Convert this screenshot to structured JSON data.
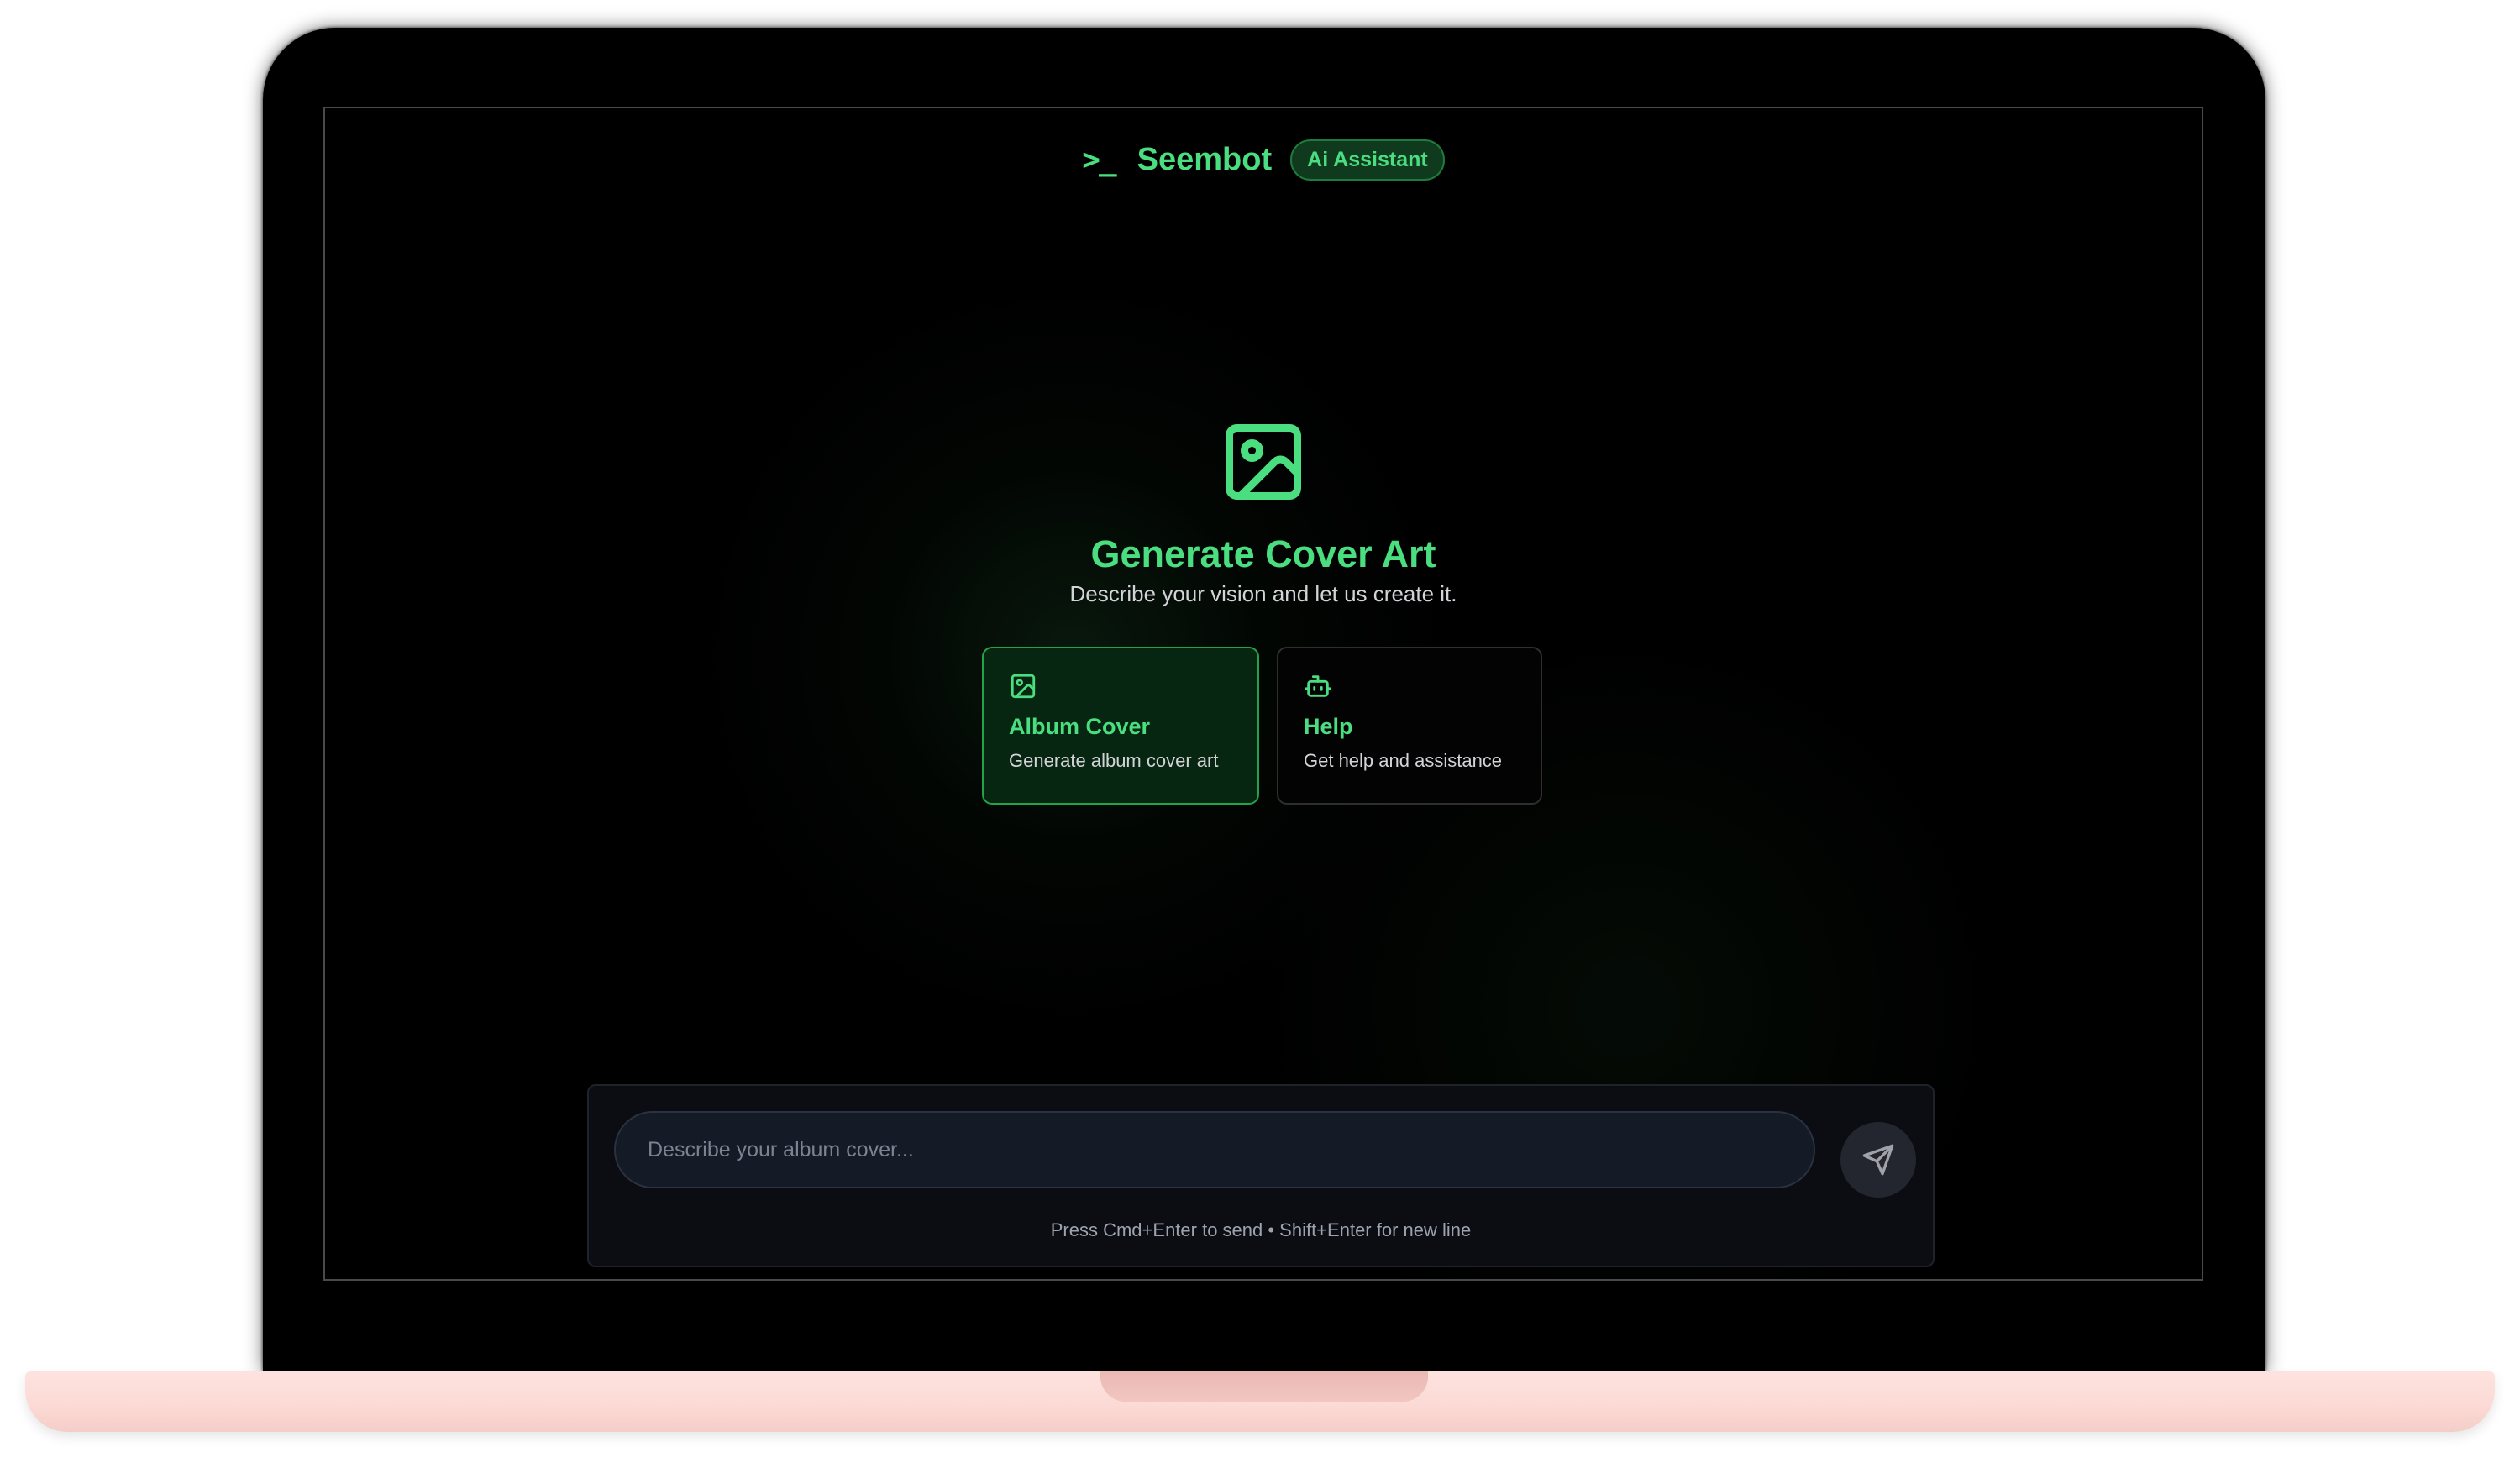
{
  "header": {
    "brand_icon": ">_",
    "brand_name": "Seembot",
    "badge": "Ai Assistant"
  },
  "hero": {
    "icon": "image-icon",
    "title": "Generate Cover Art",
    "subtitle": "Describe your vision and let us create it."
  },
  "cards": [
    {
      "icon": "image-icon",
      "title": "Album Cover",
      "description": "Generate album cover art",
      "selected": true
    },
    {
      "icon": "bot-icon",
      "title": "Help",
      "description": "Get help and assistance",
      "selected": false
    }
  ],
  "composer": {
    "value": "",
    "placeholder": "Describe your album cover...",
    "send_icon": "send-icon",
    "hint": "Press Cmd+Enter to send • Shift+Enter for new line"
  },
  "colors": {
    "accent": "#4ade80",
    "background": "#000000",
    "card_selected_bg": "#072611",
    "card_selected_border": "#22a34a",
    "laptop_base": "#fcd9d4"
  }
}
